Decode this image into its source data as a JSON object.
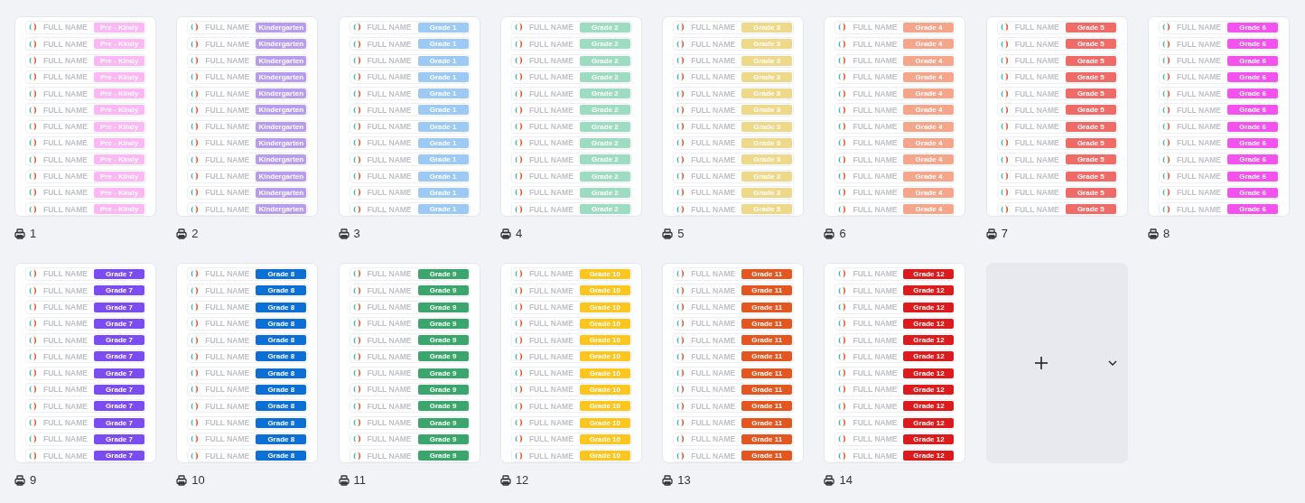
{
  "pages": [
    {
      "number": "1",
      "color": "#fbb8f4",
      "rows": [
        {
          "name": "FULL NAME",
          "grade": "Pre - Kindy"
        },
        {
          "name": "FULL NAME",
          "grade": "Pre - Kindy"
        },
        {
          "name": "FULL NAME",
          "grade": "Pre - Kindy"
        },
        {
          "name": "FULL NAME",
          "grade": "Pre - Kindy"
        },
        {
          "name": "FULL NAME",
          "grade": "Pre - Kindy"
        },
        {
          "name": "FULL NAME",
          "grade": "Pre - Kindy"
        },
        {
          "name": "FULL NAME",
          "grade": "Pre - Kindy"
        },
        {
          "name": "FULL NAME",
          "grade": "Pre - Kindy"
        },
        {
          "name": "FULL NAME",
          "grade": "Pre - Kindy"
        },
        {
          "name": "FULL NAME",
          "grade": "Pre - Kindy"
        },
        {
          "name": "FULL NAME",
          "grade": "Pre - Kindy"
        },
        {
          "name": "FULL NAME",
          "grade": "Pre - Kindy"
        }
      ]
    },
    {
      "number": "2",
      "color": "#b89cf0",
      "rows": [
        {
          "name": "FULL NAME",
          "grade": "Kindergarten"
        },
        {
          "name": "FULL NAME",
          "grade": "Kindergarten"
        },
        {
          "name": "FULL NAME",
          "grade": "Kindergarten"
        },
        {
          "name": "FULL NAME",
          "grade": "Kindergarten"
        },
        {
          "name": "FULL NAME",
          "grade": "Kindergarten"
        },
        {
          "name": "FULL NAME",
          "grade": "Kindergarten"
        },
        {
          "name": "FULL NAME",
          "grade": "Kindergarten"
        },
        {
          "name": "FULL NAME",
          "grade": "Kindergarten"
        },
        {
          "name": "FULL NAME",
          "grade": "Kindergarten"
        },
        {
          "name": "FULL NAME",
          "grade": "Kindergarten"
        },
        {
          "name": "FULL NAME",
          "grade": "Kindergarten"
        },
        {
          "name": "FULL NAME",
          "grade": "Kindergarten"
        }
      ]
    },
    {
      "number": "3",
      "color": "#9ccaf5",
      "rows": [
        {
          "name": "FULL NAME",
          "grade": "Grade 1"
        },
        {
          "name": "FULL NAME",
          "grade": "Grade 1"
        },
        {
          "name": "FULL NAME",
          "grade": "Grade 1"
        },
        {
          "name": "FULL NAME",
          "grade": "Grade 1"
        },
        {
          "name": "FULL NAME",
          "grade": "Grade 1"
        },
        {
          "name": "FULL NAME",
          "grade": "Grade 1"
        },
        {
          "name": "FULL NAME",
          "grade": "Grade 1"
        },
        {
          "name": "FULL NAME",
          "grade": "Grade 1"
        },
        {
          "name": "FULL NAME",
          "grade": "Grade 1"
        },
        {
          "name": "FULL NAME",
          "grade": "Grade 1"
        },
        {
          "name": "FULL NAME",
          "grade": "Grade 1"
        },
        {
          "name": "FULL NAME",
          "grade": "Grade 1"
        }
      ]
    },
    {
      "number": "4",
      "color": "#9edcc1",
      "rows": [
        {
          "name": "FULL NAME",
          "grade": "Grade 2"
        },
        {
          "name": "FULL NAME",
          "grade": "Grade 2"
        },
        {
          "name": "FULL NAME",
          "grade": "Grade 2"
        },
        {
          "name": "FULL NAME",
          "grade": "Grade 2"
        },
        {
          "name": "FULL NAME",
          "grade": "Grade 2"
        },
        {
          "name": "FULL NAME",
          "grade": "Grade 2"
        },
        {
          "name": "FULL NAME",
          "grade": "Grade 2"
        },
        {
          "name": "FULL NAME",
          "grade": "Grade 2"
        },
        {
          "name": "FULL NAME",
          "grade": "Grade 2"
        },
        {
          "name": "FULL NAME",
          "grade": "Grade 2"
        },
        {
          "name": "FULL NAME",
          "grade": "Grade 2"
        },
        {
          "name": "FULL NAME",
          "grade": "Grade 2"
        }
      ]
    },
    {
      "number": "5",
      "color": "#eed88a",
      "rows": [
        {
          "name": "FULL NAME",
          "grade": "Grade 3"
        },
        {
          "name": "FULL NAME",
          "grade": "Grade 3"
        },
        {
          "name": "FULL NAME",
          "grade": "Grade 3"
        },
        {
          "name": "FULL NAME",
          "grade": "Grade 3"
        },
        {
          "name": "FULL NAME",
          "grade": "Grade 3"
        },
        {
          "name": "FULL NAME",
          "grade": "Grade 3"
        },
        {
          "name": "FULL NAME",
          "grade": "Grade 3"
        },
        {
          "name": "FULL NAME",
          "grade": "Grade 3"
        },
        {
          "name": "FULL NAME",
          "grade": "Grade 3"
        },
        {
          "name": "FULL NAME",
          "grade": "Grade 3"
        },
        {
          "name": "FULL NAME",
          "grade": "Grade 3"
        },
        {
          "name": "FULL NAME",
          "grade": "Grade 3"
        }
      ]
    },
    {
      "number": "6",
      "color": "#f5a68a",
      "rows": [
        {
          "name": "FULL NAME",
          "grade": "Grade 4"
        },
        {
          "name": "FULL NAME",
          "grade": "Grade 4"
        },
        {
          "name": "FULL NAME",
          "grade": "Grade 4"
        },
        {
          "name": "FULL NAME",
          "grade": "Grade 4"
        },
        {
          "name": "FULL NAME",
          "grade": "Grade 4"
        },
        {
          "name": "FULL NAME",
          "grade": "Grade 4"
        },
        {
          "name": "FULL NAME",
          "grade": "Grade 4"
        },
        {
          "name": "FULL NAME",
          "grade": "Grade 4"
        },
        {
          "name": "FULL NAME",
          "grade": "Grade 4"
        },
        {
          "name": "FULL NAME",
          "grade": "Grade 4"
        },
        {
          "name": "FULL NAME",
          "grade": "Grade 4"
        },
        {
          "name": "FULL NAME",
          "grade": "Grade 4"
        }
      ]
    },
    {
      "number": "7",
      "color": "#ee6b67",
      "rows": [
        {
          "name": "FULL NAME",
          "grade": "Grade 5"
        },
        {
          "name": "FULL NAME",
          "grade": "Grade 5"
        },
        {
          "name": "FULL NAME",
          "grade": "Grade 5"
        },
        {
          "name": "FULL NAME",
          "grade": "Grade 5"
        },
        {
          "name": "FULL NAME",
          "grade": "Grade 5"
        },
        {
          "name": "FULL NAME",
          "grade": "Grade 5"
        },
        {
          "name": "FULL NAME",
          "grade": "Grade 5"
        },
        {
          "name": "FULL NAME",
          "grade": "Grade 5"
        },
        {
          "name": "FULL NAME",
          "grade": "Grade 5"
        },
        {
          "name": "FULL NAME",
          "grade": "Grade 5"
        },
        {
          "name": "FULL NAME",
          "grade": "Grade 5"
        },
        {
          "name": "FULL NAME",
          "grade": "Grade 5"
        }
      ]
    },
    {
      "number": "8",
      "color": "#f352ef",
      "rows": [
        {
          "name": "FULL NAME",
          "grade": "Grade 6"
        },
        {
          "name": "FULL NAME",
          "grade": "Grade 6"
        },
        {
          "name": "FULL NAME",
          "grade": "Grade 6"
        },
        {
          "name": "FULL NAME",
          "grade": "Grade 6"
        },
        {
          "name": "FULL NAME",
          "grade": "Grade 6"
        },
        {
          "name": "FULL NAME",
          "grade": "Grade 6"
        },
        {
          "name": "FULL NAME",
          "grade": "Grade 6"
        },
        {
          "name": "FULL NAME",
          "grade": "Grade 6"
        },
        {
          "name": "FULL NAME",
          "grade": "Grade 6"
        },
        {
          "name": "FULL NAME",
          "grade": "Grade 6"
        },
        {
          "name": "FULL NAME",
          "grade": "Grade 6"
        },
        {
          "name": "FULL NAME",
          "grade": "Grade 6"
        }
      ]
    },
    {
      "number": "9",
      "color": "#7b4cf0",
      "rows": [
        {
          "name": "FULL NAME",
          "grade": "Grade 7"
        },
        {
          "name": "FULL NAME",
          "grade": "Grade 7"
        },
        {
          "name": "FULL NAME",
          "grade": "Grade 7"
        },
        {
          "name": "FULL NAME",
          "grade": "Grade 7"
        },
        {
          "name": "FULL NAME",
          "grade": "Grade 7"
        },
        {
          "name": "FULL NAME",
          "grade": "Grade 7"
        },
        {
          "name": "FULL NAME",
          "grade": "Grade 7"
        },
        {
          "name": "FULL NAME",
          "grade": "Grade 7"
        },
        {
          "name": "FULL NAME",
          "grade": "Grade 7"
        },
        {
          "name": "FULL NAME",
          "grade": "Grade 7"
        },
        {
          "name": "FULL NAME",
          "grade": "Grade 7"
        },
        {
          "name": "FULL NAME",
          "grade": "Grade 7"
        }
      ]
    },
    {
      "number": "10",
      "color": "#0b6fd6",
      "rows": [
        {
          "name": "FULL NAME",
          "grade": "Grade 8"
        },
        {
          "name": "FULL NAME",
          "grade": "Grade 8"
        },
        {
          "name": "FULL NAME",
          "grade": "Grade 8"
        },
        {
          "name": "FULL NAME",
          "grade": "Grade 8"
        },
        {
          "name": "FULL NAME",
          "grade": "Grade 8"
        },
        {
          "name": "FULL NAME",
          "grade": "Grade 8"
        },
        {
          "name": "FULL NAME",
          "grade": "Grade 8"
        },
        {
          "name": "FULL NAME",
          "grade": "Grade 8"
        },
        {
          "name": "FULL NAME",
          "grade": "Grade 8"
        },
        {
          "name": "FULL NAME",
          "grade": "Grade 8"
        },
        {
          "name": "FULL NAME",
          "grade": "Grade 8"
        },
        {
          "name": "FULL NAME",
          "grade": "Grade 8"
        }
      ]
    },
    {
      "number": "11",
      "color": "#3aa66c",
      "rows": [
        {
          "name": "FULL NAME",
          "grade": "Grade 9"
        },
        {
          "name": "FULL NAME",
          "grade": "Grade 9"
        },
        {
          "name": "FULL NAME",
          "grade": "Grade 9"
        },
        {
          "name": "FULL NAME",
          "grade": "Grade 9"
        },
        {
          "name": "FULL NAME",
          "grade": "Grade 9"
        },
        {
          "name": "FULL NAME",
          "grade": "Grade 9"
        },
        {
          "name": "FULL NAME",
          "grade": "Grade 9"
        },
        {
          "name": "FULL NAME",
          "grade": "Grade 9"
        },
        {
          "name": "FULL NAME",
          "grade": "Grade 9"
        },
        {
          "name": "FULL NAME",
          "grade": "Grade 9"
        },
        {
          "name": "FULL NAME",
          "grade": "Grade 9"
        },
        {
          "name": "FULL NAME",
          "grade": "Grade 9"
        }
      ]
    },
    {
      "number": "12",
      "color": "#fdc61f",
      "rows": [
        {
          "name": "FULL NAME",
          "grade": "Grade 10"
        },
        {
          "name": "FULL NAME",
          "grade": "Grade 10"
        },
        {
          "name": "FULL NAME",
          "grade": "Grade 10"
        },
        {
          "name": "FULL NAME",
          "grade": "Grade 10"
        },
        {
          "name": "FULL NAME",
          "grade": "Grade 10"
        },
        {
          "name": "FULL NAME",
          "grade": "Grade 10"
        },
        {
          "name": "FULL NAME",
          "grade": "Grade 10"
        },
        {
          "name": "FULL NAME",
          "grade": "Grade 10"
        },
        {
          "name": "FULL NAME",
          "grade": "Grade 10"
        },
        {
          "name": "FULL NAME",
          "grade": "Grade 10"
        },
        {
          "name": "FULL NAME",
          "grade": "Grade 10"
        },
        {
          "name": "FULL NAME",
          "grade": "Grade 10"
        }
      ]
    },
    {
      "number": "13",
      "color": "#e4561f",
      "rows": [
        {
          "name": "FULL NAME",
          "grade": "Grade 11"
        },
        {
          "name": "FULL NAME",
          "grade": "Grade 11"
        },
        {
          "name": "FULL NAME",
          "grade": "Grade 11"
        },
        {
          "name": "FULL NAME",
          "grade": "Grade 11"
        },
        {
          "name": "FULL NAME",
          "grade": "Grade 11"
        },
        {
          "name": "FULL NAME",
          "grade": "Grade 11"
        },
        {
          "name": "FULL NAME",
          "grade": "Grade 11"
        },
        {
          "name": "FULL NAME",
          "grade": "Grade 11"
        },
        {
          "name": "FULL NAME",
          "grade": "Grade 11"
        },
        {
          "name": "FULL NAME",
          "grade": "Grade 11"
        },
        {
          "name": "FULL NAME",
          "grade": "Grade 11"
        },
        {
          "name": "FULL NAME",
          "grade": "Grade 11"
        }
      ]
    },
    {
      "number": "14",
      "color": "#dc1c1c",
      "rows": [
        {
          "name": "FULL NAME",
          "grade": "Grade 12"
        },
        {
          "name": "FULL NAME",
          "grade": "Grade 12"
        },
        {
          "name": "FULL NAME",
          "grade": "Grade 12"
        },
        {
          "name": "FULL NAME",
          "grade": "Grade 12"
        },
        {
          "name": "FULL NAME",
          "grade": "Grade 12"
        },
        {
          "name": "FULL NAME",
          "grade": "Grade 12"
        },
        {
          "name": "FULL NAME",
          "grade": "Grade 12"
        },
        {
          "name": "FULL NAME",
          "grade": "Grade 12"
        },
        {
          "name": "FULL NAME",
          "grade": "Grade 12"
        },
        {
          "name": "FULL NAME",
          "grade": "Grade 12"
        },
        {
          "name": "FULL NAME",
          "grade": "Grade 12"
        },
        {
          "name": "FULL NAME",
          "grade": "Grade 12"
        }
      ]
    }
  ]
}
